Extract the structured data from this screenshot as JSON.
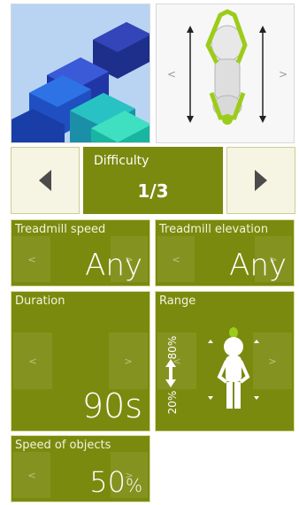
{
  "difficulty": {
    "label": "Difficulty",
    "value": "1/3"
  },
  "tiles": {
    "treadmill_speed": {
      "label": "Treadmill speed",
      "value": "Any",
      "left_arrow": "<",
      "right_arrow": ">"
    },
    "treadmill_elevation": {
      "label": "Treadmill elevation",
      "value": "Any",
      "left_arrow": "<",
      "right_arrow": ">"
    },
    "duration": {
      "label": "Duration",
      "value": "90s",
      "left_arrow": "<",
      "right_arrow": ">"
    },
    "range": {
      "label": "Range",
      "top_value": "80%",
      "bottom_value": "20%",
      "left_arrow": "<",
      "right_arrow": ">"
    },
    "speed_of_objects": {
      "label": "Speed of objects",
      "value": "50",
      "unit": "%",
      "left_arrow": "<",
      "right_arrow": ">"
    }
  },
  "preview": {
    "left_arrow": "<",
    "right_arrow": ">"
  },
  "colors": {
    "tile": "#7a8a0e",
    "tile_border": "#d7dd9f",
    "nav_bg": "#f6f4e2"
  }
}
